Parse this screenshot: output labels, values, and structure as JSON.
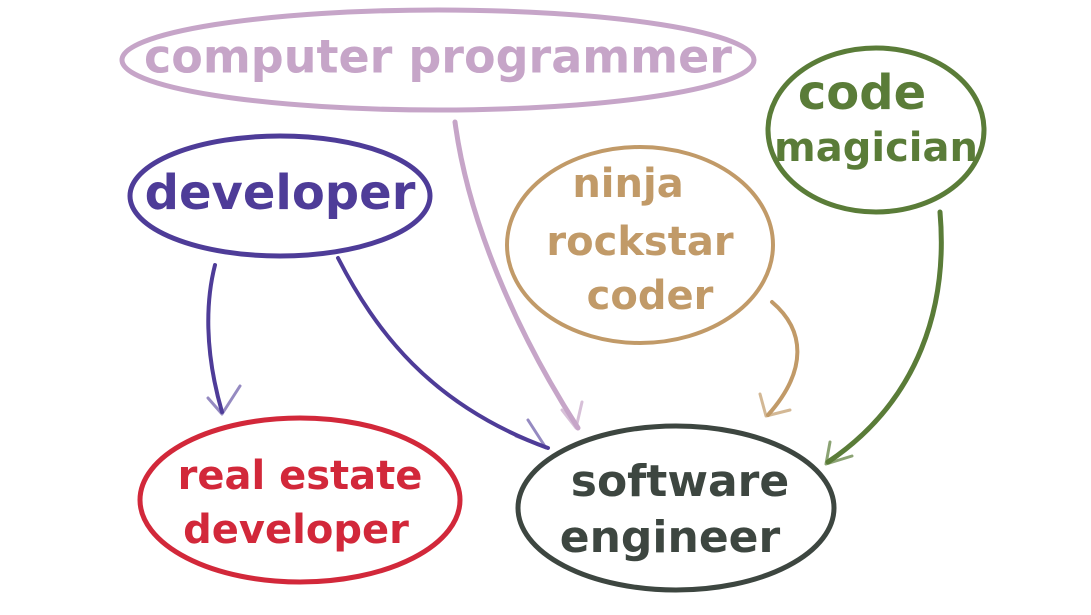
{
  "colors": {
    "background": "#ffffff",
    "computer_programmer": "#c6a5c8",
    "developer": "#4e3c98",
    "ninja": "#c19a68",
    "magician": "#5a7c38",
    "real_estate": "#d2283a",
    "software_engineer": "#3d4640"
  },
  "nodes": {
    "computer_programmer": {
      "label": "computer programmer"
    },
    "developer": {
      "label": "developer"
    },
    "ninja": {
      "line1": "ninja",
      "line2": "rockstar",
      "line3": "coder"
    },
    "magician": {
      "line1": "code",
      "line2": "magician"
    },
    "real_estate": {
      "line1": "real estate",
      "line2": "developer"
    },
    "software_engineer": {
      "line1": "software",
      "line2": "engineer"
    }
  },
  "edges": [
    {
      "from": "developer",
      "to": "real_estate"
    },
    {
      "from": "developer",
      "to": "software_engineer"
    },
    {
      "from": "computer_programmer",
      "to": "software_engineer"
    },
    {
      "from": "ninja",
      "to": "software_engineer"
    },
    {
      "from": "magician",
      "to": "software_engineer"
    }
  ]
}
